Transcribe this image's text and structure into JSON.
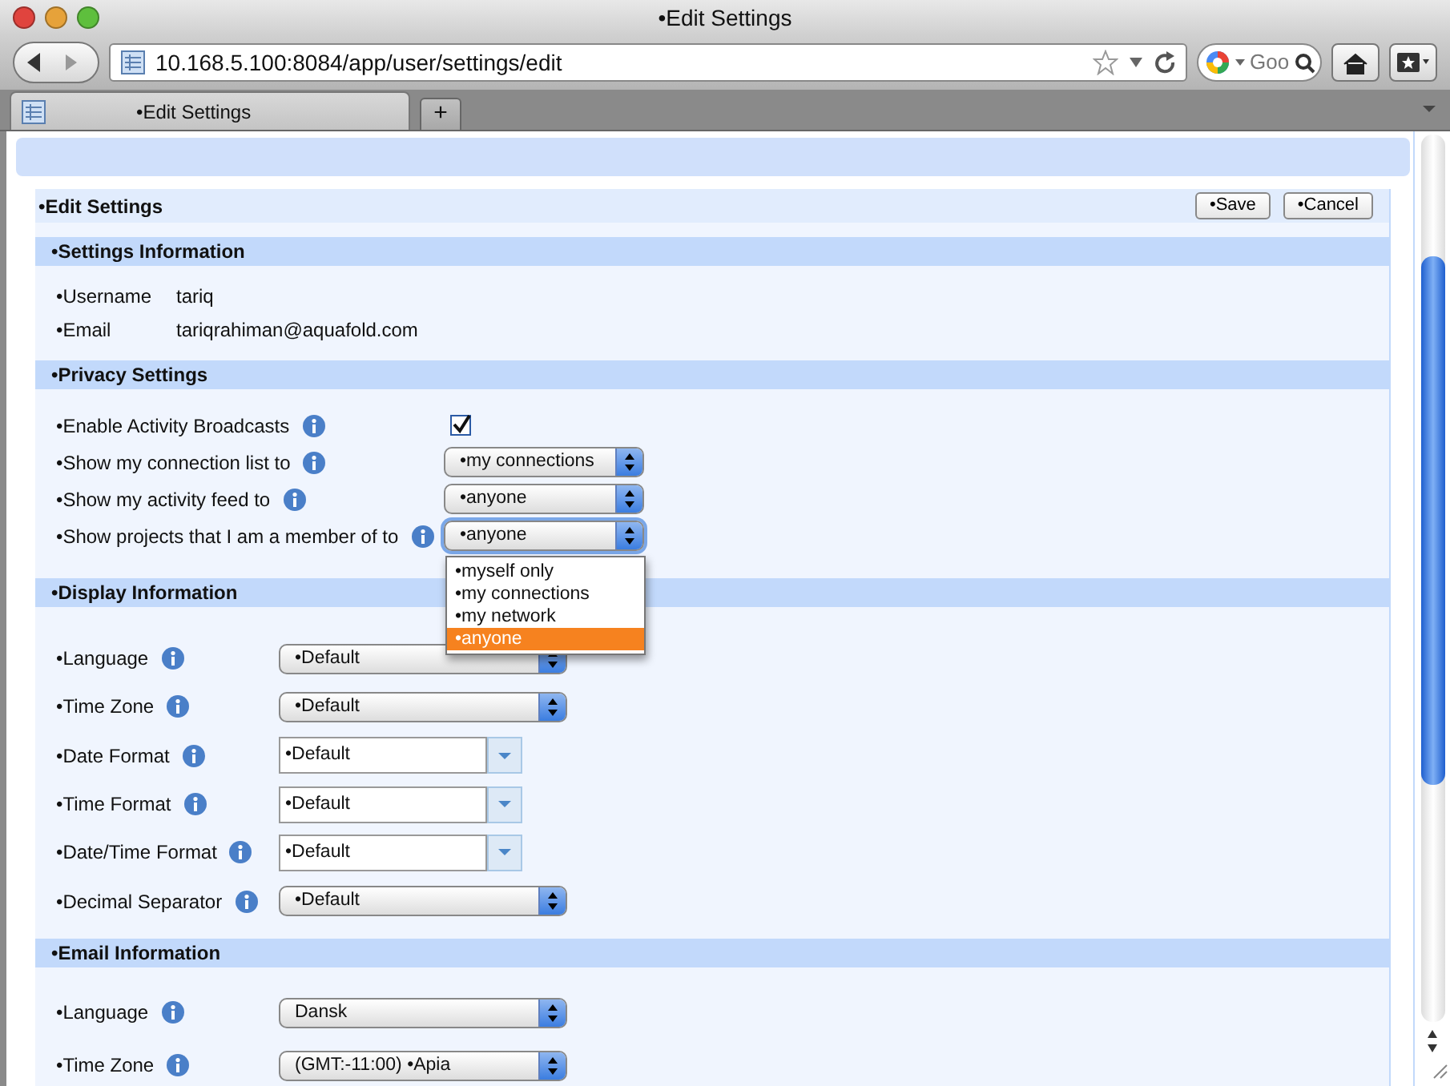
{
  "window": {
    "title": "•Edit Settings"
  },
  "toolbar": {
    "address": "10.168.5.100:8084/app/user/settings/edit",
    "search_placeholder": "Goo"
  },
  "tabs": [
    {
      "label": "•Edit Settings",
      "selected": true
    }
  ],
  "new_tab_button": "+",
  "form": {
    "title": "•Edit Settings",
    "buttons": [
      "•Save",
      "•Cancel"
    ],
    "sections": [
      {
        "title": "•Settings Information",
        "rows": [
          {
            "kind": "text",
            "label": "•Username",
            "value": "tariq"
          },
          {
            "kind": "text",
            "label": "•Email",
            "value": "tariqrahiman@aquafold.com"
          }
        ]
      },
      {
        "title": "•Privacy Settings",
        "rows": [
          {
            "kind": "checkbox",
            "label": "•Enable Activity Broadcasts",
            "checked": true
          },
          {
            "kind": "select",
            "label": "•Show my connection list to",
            "value": "•my connections",
            "expanded": false
          },
          {
            "kind": "select",
            "label": "•Show my activity feed to",
            "value": "•anyone",
            "expanded": false
          },
          {
            "kind": "select",
            "label": "•Show projects that I am a member of to",
            "value": "•anyone",
            "expanded": true,
            "options": [
              {
                "label": "•myself only",
                "selected": false
              },
              {
                "label": "•my connections",
                "selected": false
              },
              {
                "label": "•my network",
                "selected": false
              },
              {
                "label": "•anyone",
                "selected": true
              }
            ]
          }
        ]
      },
      {
        "title": "•Display Information",
        "rows": [
          {
            "kind": "select",
            "label": "•Language",
            "value": "•Default",
            "expanded": false
          },
          {
            "kind": "select",
            "label": "•Time Zone",
            "value": "•Default",
            "expanded": false
          },
          {
            "kind": "combo",
            "label": "•Date Format",
            "value": "•Default"
          },
          {
            "kind": "combo",
            "label": "•Time Format",
            "value": "•Default"
          },
          {
            "kind": "combo",
            "label": "•Date/Time Format",
            "value": "•Default"
          },
          {
            "kind": "select",
            "label": "•Decimal Separator",
            "value": "•Default",
            "expanded": false
          }
        ]
      },
      {
        "title": "•Email Information",
        "rows": [
          {
            "kind": "select",
            "label": "•Language",
            "value": "Dansk",
            "expanded": false
          },
          {
            "kind": "select",
            "label": "•Time Zone",
            "value": "(GMT:-11:00) •Apia",
            "expanded": false
          }
        ]
      }
    ]
  }
}
